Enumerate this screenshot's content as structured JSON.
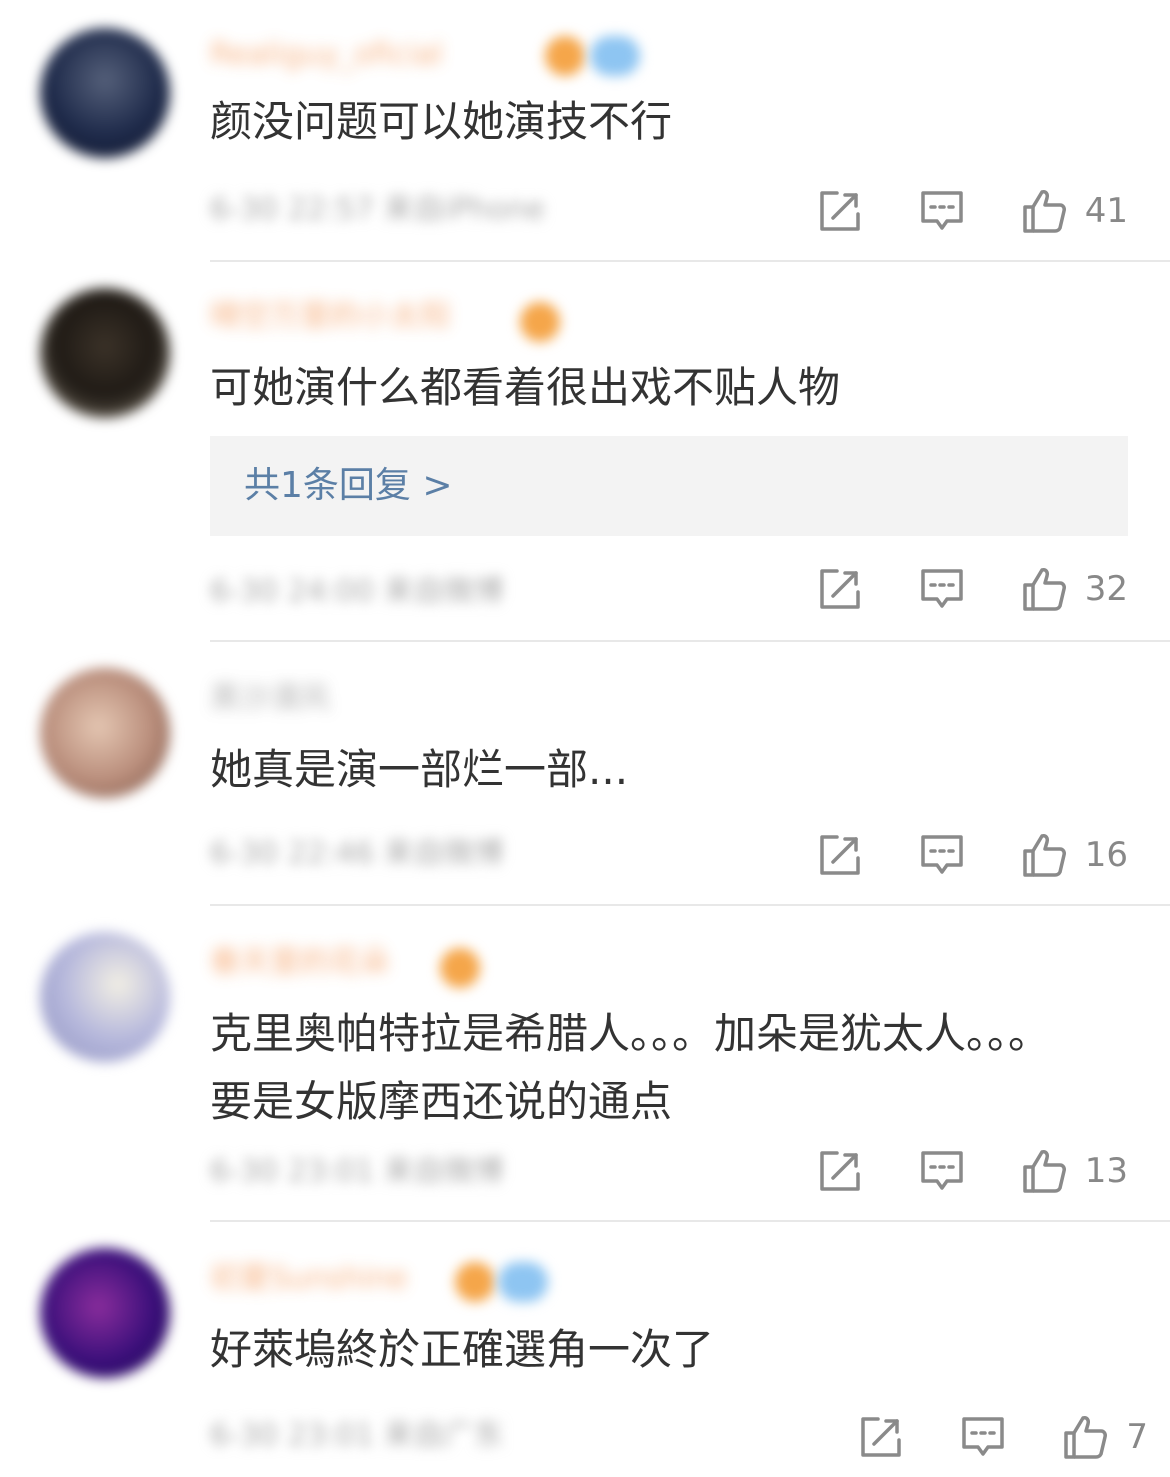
{
  "comments": [
    {
      "username": "Realiguy_oficial",
      "text": "颜没问题可以她演技不行",
      "meta": "6-30 22:57 来自iPhone",
      "likes": "41",
      "avatar_color": "#1e2a4a",
      "badge_colors": [
        "#f5a64a",
        "#8ec5f2"
      ]
    },
    {
      "username": "晴空万里的小太阳",
      "text": "可她演什么都看着很出戏不贴人物",
      "reply_label": "共1条回复 >",
      "meta": "6-30 24:00 来自微博",
      "likes": "32",
      "avatar_color": "#2c2620",
      "badge_colors": [
        "#f5a64a"
      ]
    },
    {
      "username": "黑沙漠风",
      "text": "她真是演一部烂一部...",
      "meta": "6-30 22:46 来自微博",
      "likes": "16",
      "avatar_color": "#b88c7a",
      "badge_colors": []
    },
    {
      "username": "春天里的花朵",
      "text": "克里奥帕特拉是希腊人。。。加朵是犹太人。。。要是女版摩西还说的通点",
      "meta": "6-30 23:01 来自微博",
      "likes": "13",
      "avatar_color": "#b6b8dc",
      "badge_colors": [
        "#f5a64a"
      ]
    },
    {
      "username": "初夏Sunshine",
      "text": "好萊塢終於正確選角一次了",
      "meta": "6-30 23:01 来自广东",
      "likes": "7",
      "avatar_color": "#3a0f7a",
      "badge_colors": [
        "#f5a64a",
        "#8ec5f2"
      ]
    }
  ],
  "icons": {
    "share": "share-icon",
    "reply": "comment-icon",
    "like": "thumbs-up-icon"
  },
  "colors": {
    "link": "#5b7fa6",
    "username": "#f59b5c",
    "divider": "#e8e8e8"
  }
}
